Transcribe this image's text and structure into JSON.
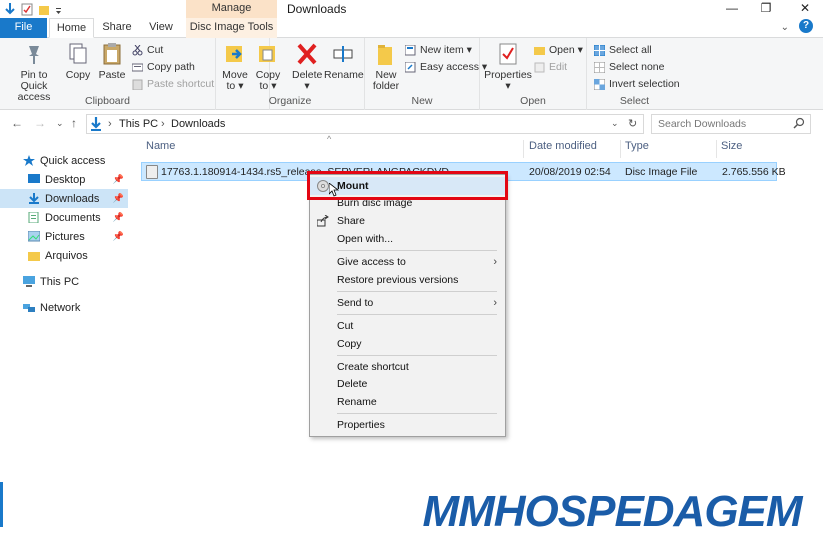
{
  "window": {
    "title": "Downloads",
    "context_tab": "Manage",
    "controls": {
      "minimize": "—",
      "maximize": "❐",
      "close": "✕"
    }
  },
  "ribbon_tabs": [
    {
      "label": "File"
    },
    {
      "label": "Home"
    },
    {
      "label": "Share"
    },
    {
      "label": "View"
    },
    {
      "label": "Disc Image Tools"
    }
  ],
  "ribbon": {
    "clipboard": {
      "label": "Clipboard",
      "pin": "Pin to Quick\naccess",
      "copy": "Copy",
      "paste": "Paste",
      "cut": "Cut",
      "copy_path": "Copy path",
      "paste_shortcut": "Paste shortcut"
    },
    "organize": {
      "label": "Organize",
      "move_to": "Move\nto ▾",
      "copy_to": "Copy\nto ▾",
      "delete": "Delete\n▾",
      "rename": "Rename"
    },
    "new": {
      "label": "New",
      "new_folder": "New\nfolder",
      "new_item": "New item ▾",
      "easy_access": "Easy access ▾"
    },
    "open": {
      "label": "Open",
      "properties": "Properties\n▾",
      "open": "Open ▾",
      "edit": "Edit"
    },
    "select": {
      "label": "Select",
      "select_all": "Select all",
      "select_none": "Select none",
      "invert": "Invert selection"
    }
  },
  "address": {
    "path": [
      "This PC",
      "Downloads"
    ],
    "separator": "›",
    "search_placeholder": "Search Downloads"
  },
  "nav": {
    "items": [
      {
        "label": "Quick access",
        "pinned": false
      },
      {
        "label": "Desktop",
        "pinned": true
      },
      {
        "label": "Downloads",
        "pinned": true
      },
      {
        "label": "Documents",
        "pinned": true
      },
      {
        "label": "Pictures",
        "pinned": true
      },
      {
        "label": "Arquivos",
        "pinned": false
      },
      {
        "label": "This PC",
        "pinned": false
      },
      {
        "label": "Network",
        "pinned": false
      }
    ],
    "pin_glyph": "📌"
  },
  "columns": {
    "name": "Name",
    "date": "Date modified",
    "type": "Type",
    "size": "Size"
  },
  "files": [
    {
      "name": "17763.1.180914-1434.rs5_release_SERVERLANGPACKDVD_OEM_MULTI",
      "date": "20/08/2019 02:54",
      "type": "Disc Image File",
      "size": "2.765.556 KB"
    }
  ],
  "context_menu": {
    "items": [
      {
        "label": "Mount"
      },
      {
        "label": "Burn disc image"
      },
      {
        "label": "Share"
      },
      {
        "label": "Open with..."
      },
      {
        "label": "Give access to"
      },
      {
        "label": "Restore previous versions"
      },
      {
        "label": "Send to"
      },
      {
        "label": "Cut"
      },
      {
        "label": "Copy"
      },
      {
        "label": "Create shortcut"
      },
      {
        "label": "Delete"
      },
      {
        "label": "Rename"
      },
      {
        "label": "Properties"
      }
    ],
    "submenu_arrow": "›"
  },
  "watermark": {
    "text": "MMHOSPEDAGEM"
  },
  "colors": {
    "accent": "#1979ca",
    "selection": "#cce8ff",
    "manage_tab": "#fbe2c8",
    "highlight_box": "#e30613",
    "watermark_blue": "#1a5ca8"
  }
}
